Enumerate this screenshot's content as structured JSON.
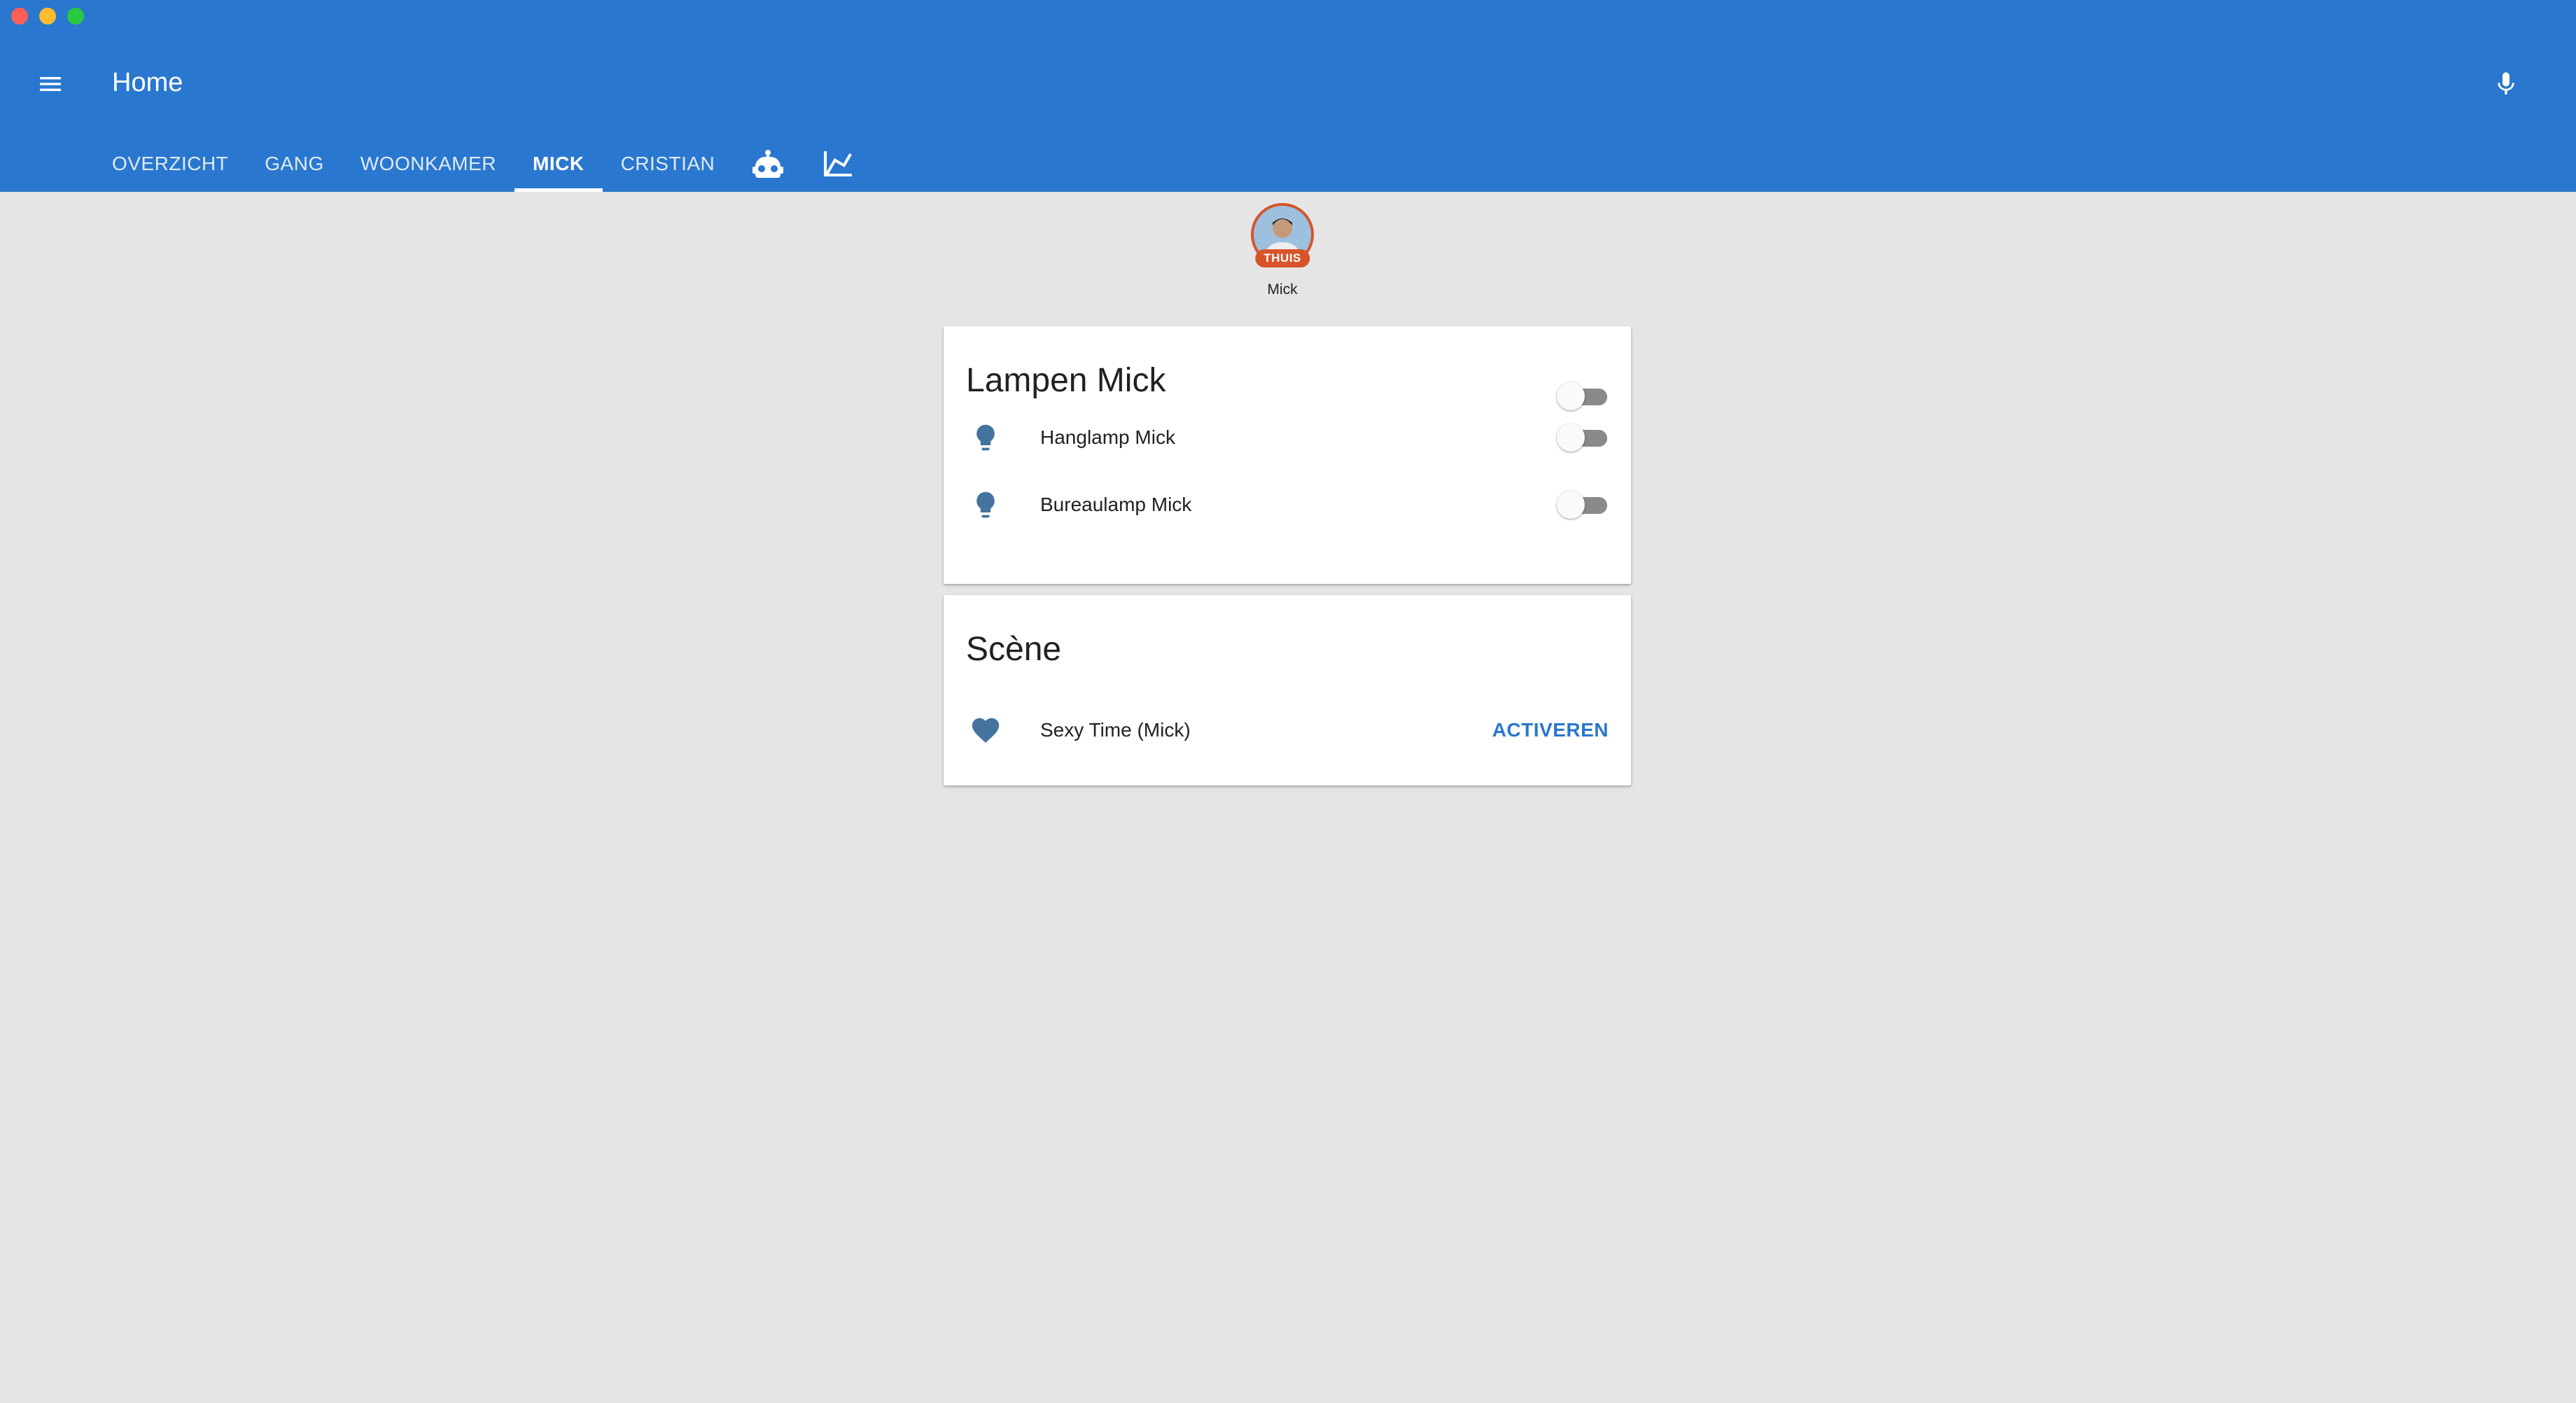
{
  "window": {
    "controls": [
      "close",
      "minimize",
      "maximize"
    ]
  },
  "header": {
    "title": "Home",
    "menu_icon": "menu-icon",
    "voice_icon": "microphone-icon"
  },
  "tabs": [
    {
      "label": "OVERZICHT",
      "active": false
    },
    {
      "label": "GANG",
      "active": false
    },
    {
      "label": "WOONKAMER",
      "active": false
    },
    {
      "label": "MICK",
      "active": true
    },
    {
      "label": "CRISTIAN",
      "active": false
    }
  ],
  "tab_icons": [
    "robot-icon",
    "chart-line-icon"
  ],
  "person": {
    "name": "Mick",
    "state_badge": "THUIS"
  },
  "cards": {
    "lights": {
      "title": "Lampen Mick",
      "group_toggle_on": false,
      "items": [
        {
          "name": "Hanglamp Mick",
          "icon": "lightbulb-icon",
          "on": false
        },
        {
          "name": "Bureaulamp Mick",
          "icon": "lightbulb-icon",
          "on": false
        }
      ]
    },
    "scene": {
      "title": "Scène",
      "items": [
        {
          "name": "Sexy Time (Mick)",
          "icon": "heart-icon",
          "action_label": "ACTIVEREN"
        }
      ]
    }
  },
  "colors": {
    "primary": "#2a77cf",
    "background": "#e5e5e5",
    "icon": "#44739e",
    "badge": "#d8532a",
    "toggle_off_track": "#8a8a8a"
  }
}
